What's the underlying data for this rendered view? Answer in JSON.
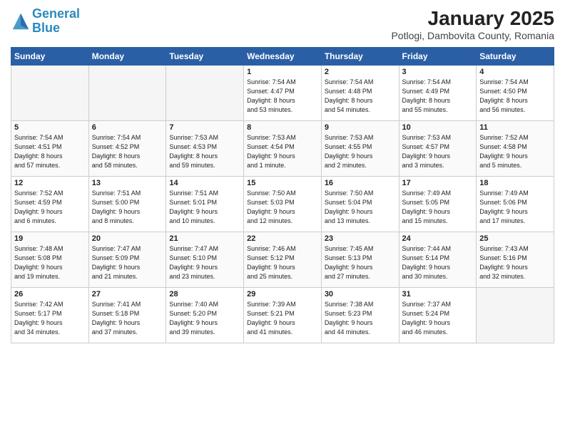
{
  "logo": {
    "line1": "General",
    "line2": "Blue"
  },
  "title": "January 2025",
  "subtitle": "Potlogi, Dambovita County, Romania",
  "days_header": [
    "Sunday",
    "Monday",
    "Tuesday",
    "Wednesday",
    "Thursday",
    "Friday",
    "Saturday"
  ],
  "weeks": [
    [
      {
        "day": "",
        "info": ""
      },
      {
        "day": "",
        "info": ""
      },
      {
        "day": "",
        "info": ""
      },
      {
        "day": "1",
        "info": "Sunrise: 7:54 AM\nSunset: 4:47 PM\nDaylight: 8 hours\nand 53 minutes."
      },
      {
        "day": "2",
        "info": "Sunrise: 7:54 AM\nSunset: 4:48 PM\nDaylight: 8 hours\nand 54 minutes."
      },
      {
        "day": "3",
        "info": "Sunrise: 7:54 AM\nSunset: 4:49 PM\nDaylight: 8 hours\nand 55 minutes."
      },
      {
        "day": "4",
        "info": "Sunrise: 7:54 AM\nSunset: 4:50 PM\nDaylight: 8 hours\nand 56 minutes."
      }
    ],
    [
      {
        "day": "5",
        "info": "Sunrise: 7:54 AM\nSunset: 4:51 PM\nDaylight: 8 hours\nand 57 minutes."
      },
      {
        "day": "6",
        "info": "Sunrise: 7:54 AM\nSunset: 4:52 PM\nDaylight: 8 hours\nand 58 minutes."
      },
      {
        "day": "7",
        "info": "Sunrise: 7:53 AM\nSunset: 4:53 PM\nDaylight: 8 hours\nand 59 minutes."
      },
      {
        "day": "8",
        "info": "Sunrise: 7:53 AM\nSunset: 4:54 PM\nDaylight: 9 hours\nand 1 minute."
      },
      {
        "day": "9",
        "info": "Sunrise: 7:53 AM\nSunset: 4:55 PM\nDaylight: 9 hours\nand 2 minutes."
      },
      {
        "day": "10",
        "info": "Sunrise: 7:53 AM\nSunset: 4:57 PM\nDaylight: 9 hours\nand 3 minutes."
      },
      {
        "day": "11",
        "info": "Sunrise: 7:52 AM\nSunset: 4:58 PM\nDaylight: 9 hours\nand 5 minutes."
      }
    ],
    [
      {
        "day": "12",
        "info": "Sunrise: 7:52 AM\nSunset: 4:59 PM\nDaylight: 9 hours\nand 6 minutes."
      },
      {
        "day": "13",
        "info": "Sunrise: 7:51 AM\nSunset: 5:00 PM\nDaylight: 9 hours\nand 8 minutes."
      },
      {
        "day": "14",
        "info": "Sunrise: 7:51 AM\nSunset: 5:01 PM\nDaylight: 9 hours\nand 10 minutes."
      },
      {
        "day": "15",
        "info": "Sunrise: 7:50 AM\nSunset: 5:03 PM\nDaylight: 9 hours\nand 12 minutes."
      },
      {
        "day": "16",
        "info": "Sunrise: 7:50 AM\nSunset: 5:04 PM\nDaylight: 9 hours\nand 13 minutes."
      },
      {
        "day": "17",
        "info": "Sunrise: 7:49 AM\nSunset: 5:05 PM\nDaylight: 9 hours\nand 15 minutes."
      },
      {
        "day": "18",
        "info": "Sunrise: 7:49 AM\nSunset: 5:06 PM\nDaylight: 9 hours\nand 17 minutes."
      }
    ],
    [
      {
        "day": "19",
        "info": "Sunrise: 7:48 AM\nSunset: 5:08 PM\nDaylight: 9 hours\nand 19 minutes."
      },
      {
        "day": "20",
        "info": "Sunrise: 7:47 AM\nSunset: 5:09 PM\nDaylight: 9 hours\nand 21 minutes."
      },
      {
        "day": "21",
        "info": "Sunrise: 7:47 AM\nSunset: 5:10 PM\nDaylight: 9 hours\nand 23 minutes."
      },
      {
        "day": "22",
        "info": "Sunrise: 7:46 AM\nSunset: 5:12 PM\nDaylight: 9 hours\nand 25 minutes."
      },
      {
        "day": "23",
        "info": "Sunrise: 7:45 AM\nSunset: 5:13 PM\nDaylight: 9 hours\nand 27 minutes."
      },
      {
        "day": "24",
        "info": "Sunrise: 7:44 AM\nSunset: 5:14 PM\nDaylight: 9 hours\nand 30 minutes."
      },
      {
        "day": "25",
        "info": "Sunrise: 7:43 AM\nSunset: 5:16 PM\nDaylight: 9 hours\nand 32 minutes."
      }
    ],
    [
      {
        "day": "26",
        "info": "Sunrise: 7:42 AM\nSunset: 5:17 PM\nDaylight: 9 hours\nand 34 minutes."
      },
      {
        "day": "27",
        "info": "Sunrise: 7:41 AM\nSunset: 5:18 PM\nDaylight: 9 hours\nand 37 minutes."
      },
      {
        "day": "28",
        "info": "Sunrise: 7:40 AM\nSunset: 5:20 PM\nDaylight: 9 hours\nand 39 minutes."
      },
      {
        "day": "29",
        "info": "Sunrise: 7:39 AM\nSunset: 5:21 PM\nDaylight: 9 hours\nand 41 minutes."
      },
      {
        "day": "30",
        "info": "Sunrise: 7:38 AM\nSunset: 5:23 PM\nDaylight: 9 hours\nand 44 minutes."
      },
      {
        "day": "31",
        "info": "Sunrise: 7:37 AM\nSunset: 5:24 PM\nDaylight: 9 hours\nand 46 minutes."
      },
      {
        "day": "",
        "info": ""
      }
    ]
  ]
}
